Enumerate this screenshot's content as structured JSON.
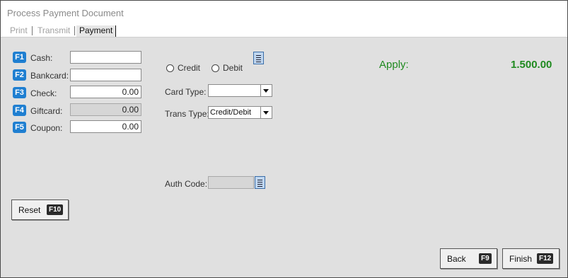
{
  "window": {
    "title": "Process Payment Document"
  },
  "tabs": [
    {
      "label": "Print",
      "active": false
    },
    {
      "label": "Transmit",
      "active": false
    },
    {
      "label": "Payment",
      "active": true
    }
  ],
  "payment_fields": [
    {
      "key": "F1",
      "label": "Cash:",
      "value": "",
      "enabled": true
    },
    {
      "key": "F2",
      "label": "Bankcard:",
      "value": "",
      "enabled": true
    },
    {
      "key": "F3",
      "label": "Check:",
      "value": "0.00",
      "enabled": true
    },
    {
      "key": "F4",
      "label": "Giftcard:",
      "value": "0.00",
      "enabled": false
    },
    {
      "key": "F5",
      "label": "Coupon:",
      "value": "0.00",
      "enabled": true
    }
  ],
  "card": {
    "credit_label": "Credit",
    "debit_label": "Debit",
    "card_type_label": "Card Type:",
    "card_type_value": "",
    "trans_type_label": "Trans Type:",
    "trans_type_value": "Credit/Debit",
    "auth_code_label": "Auth Code:",
    "auth_code_value": ""
  },
  "apply": {
    "label": "Apply:",
    "amount": "1.500.00",
    "color": "#1f8a1f"
  },
  "buttons": {
    "reset": {
      "label": "Reset",
      "key": "F10"
    },
    "back": {
      "label": "Back",
      "key": "F9"
    },
    "finish": {
      "label": "Finish",
      "key": "F12"
    }
  },
  "colors": {
    "fkey_badge": "#1f7fd1",
    "content_bg": "#e0e0e0"
  },
  "icons": {
    "list_button": "list-icon",
    "dropdown": "chevron-down-icon"
  }
}
